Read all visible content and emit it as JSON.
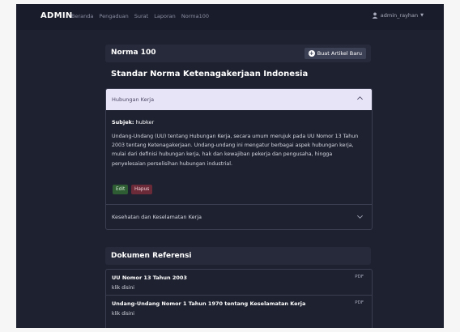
{
  "navbar": {
    "brand": "ADMIN",
    "links": [
      "Beranda",
      "Pengaduan",
      "Surat",
      "Laporan",
      "Norma100"
    ],
    "user": "admin_rayhan"
  },
  "card": {
    "title": "Norma 100",
    "new_button": "Buat Artikel Baru"
  },
  "section_title": "Standar Norma Ketenagakerjaan Indonesia",
  "accordion": {
    "item1": {
      "label": "Hubungan Kerja",
      "subject_label": "Subjek:",
      "subject_value": "hubker",
      "description": "Undang-Undang (UU) tentang Hubungan Kerja, secara umum merujuk pada UU Nomor 13 Tahun 2003 tentang Ketenagakerjaan. Undang-undang ini mengatur berbagai aspek hubungan kerja, mulai dari definisi hubungan kerja, hak dan kewajiban pekerja dan pengusaha, hingga penyelesaian perselisihan hubungan industrial.",
      "edit_label": "Edit",
      "delete_label": "Hapus"
    },
    "item2": {
      "label": "Kesehatan dan Keselamatan Kerja"
    }
  },
  "references": {
    "title": "Dokumen Referensi",
    "items": [
      {
        "name": "UU Nomor 13 Tahun 2003",
        "link": "klik disini",
        "type": "PDF"
      },
      {
        "name": "Undang-Undang Nomor 1 Tahun 1970 tentang Keselamatan Kerja",
        "link": "klik disini",
        "type": "PDF"
      }
    ]
  }
}
